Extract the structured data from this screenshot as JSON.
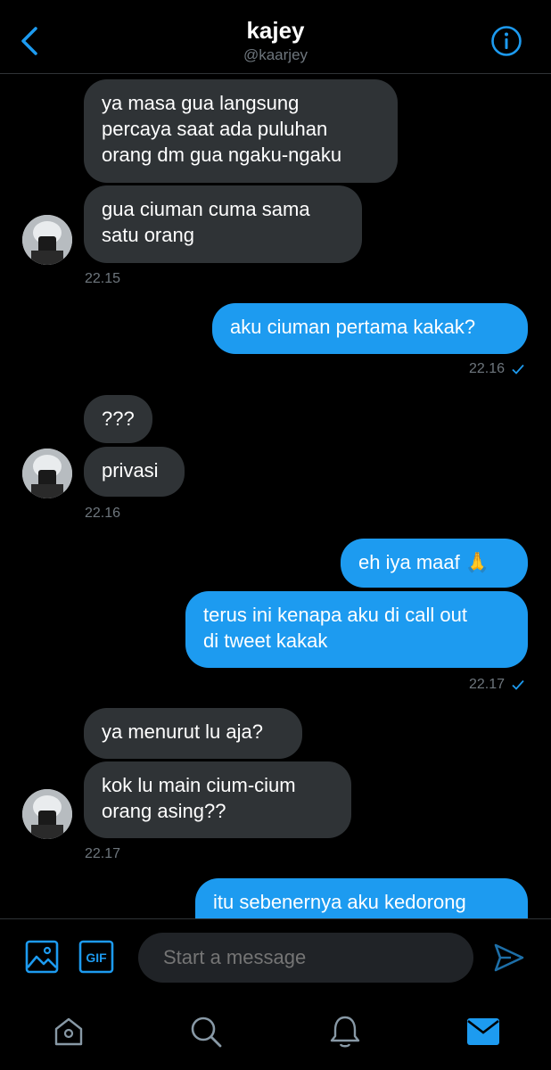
{
  "header": {
    "title": "kajey",
    "handle": "@kaarjey"
  },
  "conversation": {
    "block1": {
      "messages": [
        "ya masa gua langsung\npercaya saat ada puluhan\norang dm gua ngaku-ngaku",
        "gua ciuman cuma sama\nsatu orang"
      ],
      "time": "22.15"
    },
    "block2": {
      "messages": [
        "aku ciuman pertama kakak?"
      ],
      "time": "22.16"
    },
    "block3": {
      "messages": [
        "???",
        "privasi"
      ],
      "time": "22.16"
    },
    "block4": {
      "messages": [
        "eh iya maaf 🙏",
        "terus ini kenapa aku di call out\ndi tweet kakak"
      ],
      "time": "22.17"
    },
    "block5": {
      "messages": [
        "ya menurut lu aja?",
        "kok lu main cium-cium\norang asing??"
      ],
      "time": "22.17"
    },
    "block6": {
      "messages": [
        "itu sebenernya aku kedorong"
      ]
    }
  },
  "composer": {
    "placeholder": "Start a message",
    "gif_label": "GIF"
  },
  "colors": {
    "accent": "#1d9bf0",
    "bubble_in": "#2f3336",
    "muted": "#6e767d",
    "background": "#000000"
  },
  "icons": {
    "header": [
      "back-arrow-icon",
      "info-icon"
    ],
    "composer": [
      "image-icon",
      "gif-icon",
      "send-icon"
    ],
    "nav": [
      "home-icon",
      "search-icon",
      "notifications-icon",
      "messages-icon"
    ]
  }
}
